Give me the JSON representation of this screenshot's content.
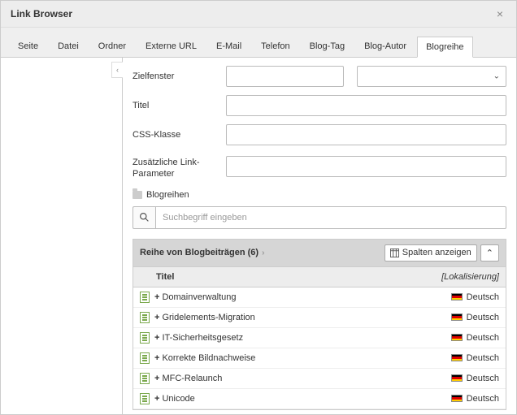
{
  "modal": {
    "title": "Link Browser"
  },
  "tabs": [
    "Seite",
    "Datei",
    "Ordner",
    "Externe URL",
    "E-Mail",
    "Telefon",
    "Blog-Tag",
    "Blog-Autor",
    "Blogreihe"
  ],
  "active_tab_index": 8,
  "form": {
    "target_label": "Zielfenster",
    "target_value": "",
    "target_select_value": "",
    "title_label": "Titel",
    "title_value": "",
    "css_label": "CSS-Klasse",
    "css_value": "",
    "params_label": "Zusätzliche Link-Parameter",
    "params_value": ""
  },
  "section": {
    "label": "Blogreihen"
  },
  "search": {
    "placeholder": "Suchbegriff eingeben"
  },
  "listing": {
    "title": "Reihe von Blogbeiträgen (6)",
    "columns_btn": "Spalten anzeigen",
    "col_title": "Titel",
    "col_loc": "[Lokalisierung]",
    "rows": [
      {
        "title": "Domainverwaltung",
        "lang": "Deutsch"
      },
      {
        "title": "Gridelements-Migration",
        "lang": "Deutsch"
      },
      {
        "title": "IT-Sicherheitsgesetz",
        "lang": "Deutsch"
      },
      {
        "title": "Korrekte Bildnachweise",
        "lang": "Deutsch"
      },
      {
        "title": "MFC-Relaunch",
        "lang": "Deutsch"
      },
      {
        "title": "Unicode",
        "lang": "Deutsch"
      }
    ]
  },
  "flag_colors": [
    "#000000",
    "#dd0000",
    "#ffcc00"
  ]
}
